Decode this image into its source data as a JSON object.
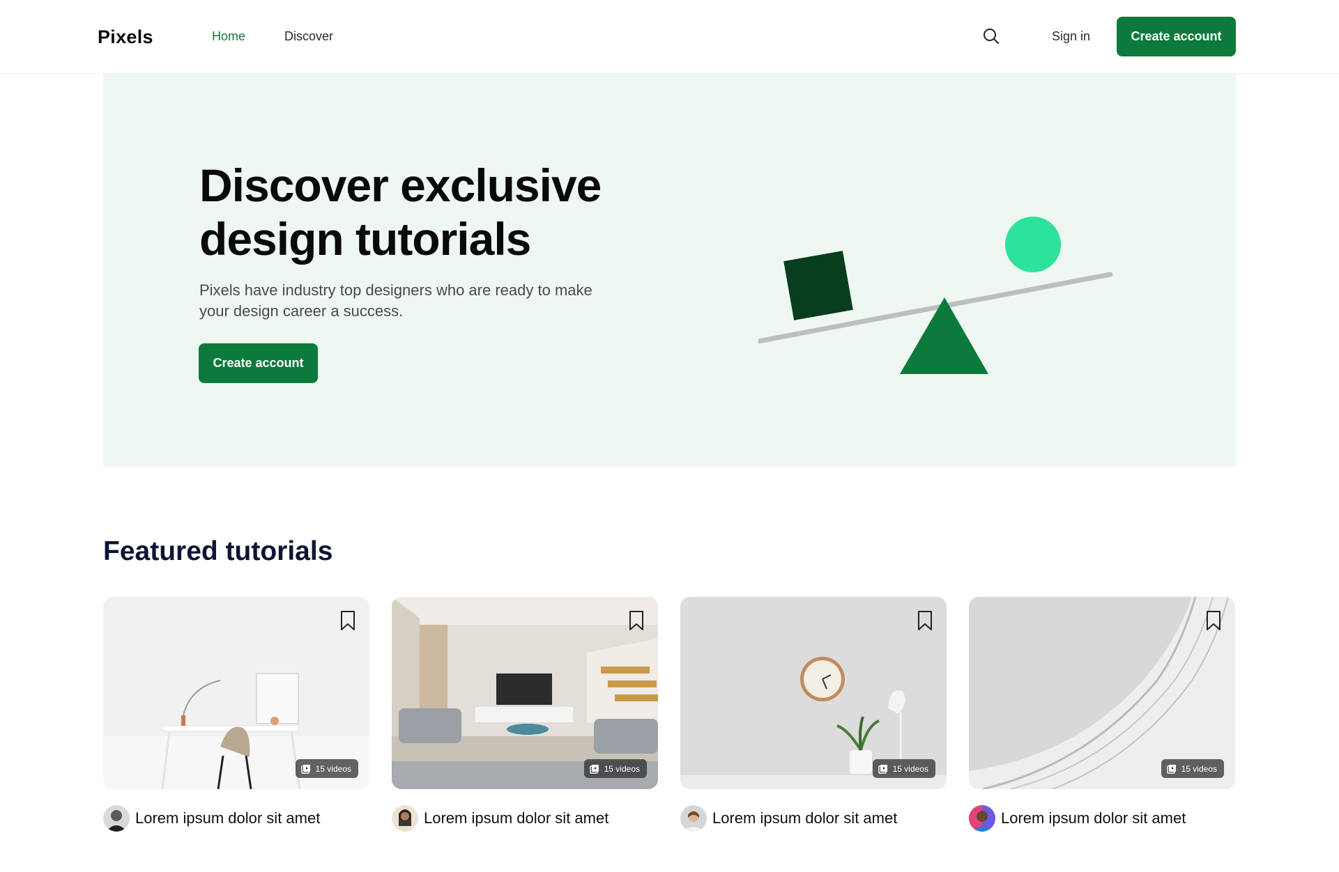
{
  "header": {
    "logo": "Pixels",
    "nav": [
      {
        "label": "Home",
        "active": true
      },
      {
        "label": "Discover",
        "active": false
      }
    ],
    "search_icon": "search-icon",
    "sign_in": "Sign in",
    "cta": "Create account"
  },
  "hero": {
    "title": "Discover exclusive design tutorials",
    "subtitle": "Pixels have industry top designers who are ready to make your design career a success.",
    "cta": "Create account"
  },
  "featured": {
    "title": "Featured tutorials",
    "cards": [
      {
        "title": "Lorem ipsum dolor sit amet",
        "badge": "15 videos"
      },
      {
        "title": "Lorem ipsum dolor sit amet",
        "badge": "15 videos"
      },
      {
        "title": "Lorem ipsum dolor sit amet",
        "badge": "15 videos"
      },
      {
        "title": "Lorem ipsum dolor sit amet",
        "badge": "15 videos"
      }
    ]
  },
  "colors": {
    "brand": "#0b7a3a",
    "hero_bg": "#eef7f2",
    "dark_green": "#083d1d",
    "mint": "#2de29a"
  }
}
